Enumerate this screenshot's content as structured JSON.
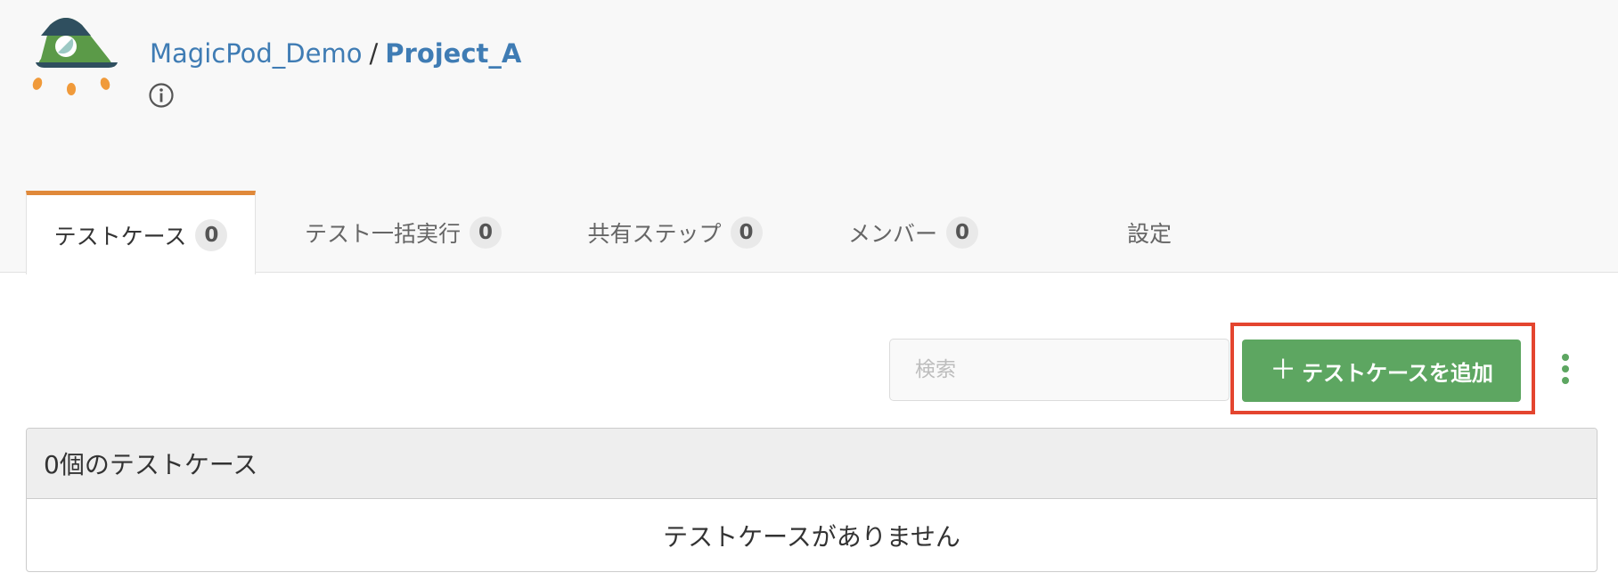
{
  "breadcrumb": {
    "organization": "MagicPod_Demo",
    "separator": "/",
    "project": "Project_A"
  },
  "tabs": [
    {
      "label": "テストケース",
      "count": "0",
      "active": true
    },
    {
      "label": "テスト一括実行",
      "count": "0",
      "active": false
    },
    {
      "label": "共有ステップ",
      "count": "0",
      "active": false
    },
    {
      "label": "メンバー",
      "count": "0",
      "active": false
    },
    {
      "label": "設定",
      "active": false
    }
  ],
  "search": {
    "placeholder": "検索",
    "value": ""
  },
  "add_button": {
    "icon": "plus-icon",
    "label": "テストケースを追加"
  },
  "panel": {
    "header": "0個のテストケース",
    "empty_message": "テストケースがありません"
  },
  "icons": {
    "logo": "rocket-logo",
    "info": "info-icon",
    "more": "vertical-ellipsis-icon"
  },
  "colors": {
    "link": "#3f7cb4",
    "active_tab_accent": "#e0893a",
    "primary_button": "#5da661",
    "highlight": "#e4452f"
  }
}
